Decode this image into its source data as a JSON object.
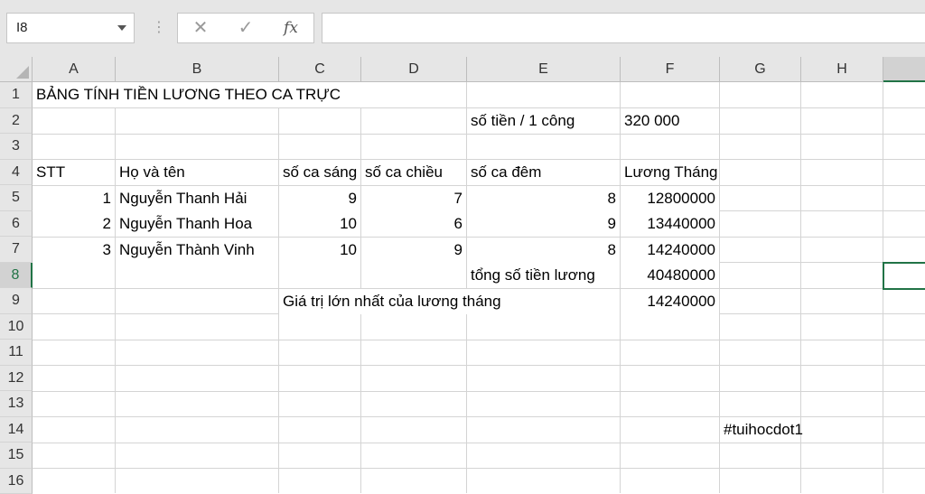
{
  "name_box": {
    "value": "I8"
  },
  "formula_bar": {
    "cancel_glyph": "✕",
    "enter_glyph": "✓",
    "fx_glyph": "fx",
    "formula": ""
  },
  "columns": [
    "A",
    "B",
    "C",
    "D",
    "E",
    "F",
    "G",
    "H"
  ],
  "rows": [
    "1",
    "2",
    "3",
    "4",
    "5",
    "6",
    "7",
    "8",
    "9",
    "10",
    "11",
    "12",
    "13",
    "14",
    "15",
    "16"
  ],
  "cells": {
    "title": "BẢNG TÍNH TIỀN LƯƠNG THEO CA TRỰC",
    "rate_label": "số tiền / 1 công",
    "rate_value": "320 000",
    "hdr_stt": "STT",
    "hdr_name": "Họ và tên",
    "hdr_morning": "số ca sáng",
    "hdr_afternoon": "số ca chiều",
    "hdr_night": "số ca đêm",
    "hdr_salary": "Lương Tháng",
    "r5": {
      "stt": "1",
      "name": "Nguyễn Thanh Hải",
      "morning": "9",
      "afternoon": "7",
      "night": "8",
      "salary": "12800000"
    },
    "r6": {
      "stt": "2",
      "name": "Nguyễn Thanh Hoa",
      "morning": "10",
      "afternoon": "6",
      "night": "9",
      "salary": "13440000"
    },
    "r7": {
      "stt": "3",
      "name": "Nguyễn Thành Vinh",
      "morning": "10",
      "afternoon": "9",
      "night": "8",
      "salary": "14240000"
    },
    "total_label": "tổng số tiền lương",
    "total_value": "40480000",
    "max_label": "Giá trị lớn nhất của lương tháng",
    "max_value": "14240000",
    "hashtag": "#tuihocdot1"
  }
}
